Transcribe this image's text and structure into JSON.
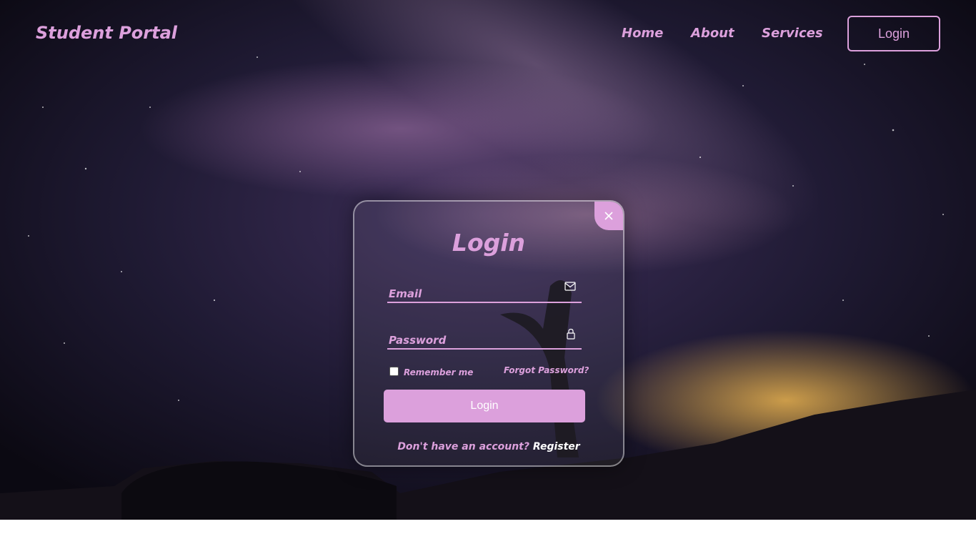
{
  "nav": {
    "logo": "Student Portal",
    "links": [
      "Home",
      "About",
      "Services"
    ],
    "login_button": "Login"
  },
  "login_form": {
    "title": "Login",
    "email_label": "Email",
    "password_label": "Password",
    "remember_label": "Remember me",
    "forgot_link": "Forgot Password?",
    "submit_label": "Login",
    "register_prompt": "Don't have an account?",
    "register_link": "Register"
  },
  "icons": {
    "close": "close-icon",
    "email": "mail-icon",
    "password": "lock-icon"
  },
  "colors": {
    "accent": "#dca0dc",
    "white": "#ffffff"
  }
}
